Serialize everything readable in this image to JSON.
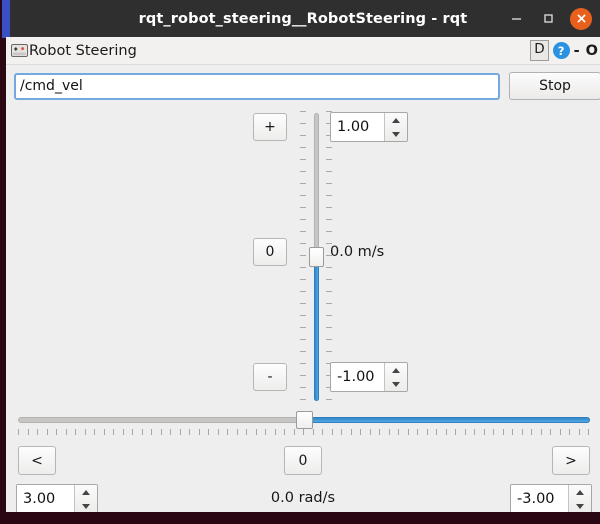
{
  "window": {
    "title": "rqt_robot_steering__RobotSteering - rqt",
    "controls": {
      "minimize_label": "–",
      "maximize_label": "□",
      "close_label": "✕"
    }
  },
  "plugin_bar": {
    "icon": "gamepad-icon",
    "title": "Robot Steering",
    "dock_label": "D",
    "help_label": "?",
    "dash_label": "-",
    "overflow_label": "O"
  },
  "topic": {
    "value": "/cmd_vel",
    "placeholder": "/cmd_vel",
    "stop_label": "Stop"
  },
  "linear": {
    "increase_label": "+",
    "reset_label": "0",
    "decrease_label": "-",
    "max_value": "1.00",
    "min_value": "-1.00",
    "readout": "0.0 m/s",
    "slider_position_percent": 50
  },
  "angular": {
    "left_label": "<",
    "reset_label": "0",
    "right_label": ">",
    "max_value": "3.00",
    "min_value": "-3.00",
    "readout": "0.0 rad/s",
    "slider_position_percent": 50
  },
  "colors": {
    "titlebar_bg": "#302f2f",
    "titlebar_text": "#ffffff",
    "close_button": "#e8601c",
    "accent_blue": "#3a4fc4",
    "slider_fill": "#3f95d5",
    "help_badge": "#2a92e0",
    "window_bg": "#efeeee",
    "desktop_bg": "#2a0712",
    "focus_border": "#74a8de"
  }
}
